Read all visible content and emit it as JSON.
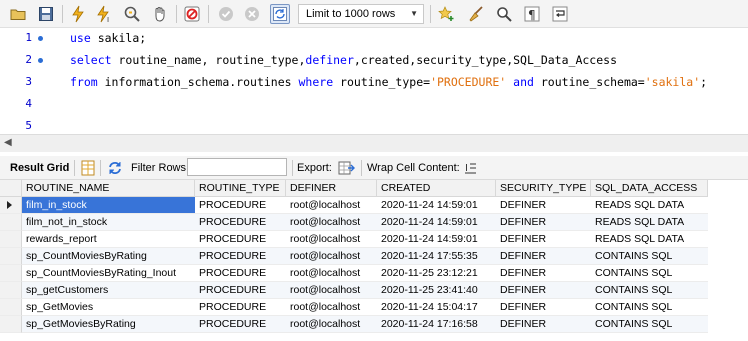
{
  "toolbar": {
    "limit_label": "Limit to 1000 rows"
  },
  "editor": {
    "lines": [
      {
        "num": "1",
        "has_dot": true
      },
      {
        "num": "2",
        "has_dot": true
      },
      {
        "num": "3",
        "has_dot": false
      },
      {
        "num": "4",
        "has_dot": false
      },
      {
        "num": "5",
        "has_dot": false
      }
    ],
    "line1": {
      "kw": "use",
      "rest": " sakila;"
    },
    "line2": {
      "kw": "select",
      "rest": " routine_name, routine_type,",
      "kw2": "definer",
      "rest2": ",created,security_type,SQL_Data_Access"
    },
    "line3": {
      "kw": "from",
      "rest": " information_schema.routines ",
      "kw2": "where",
      "rest2": " routine_type=",
      "str1": "'PROCEDURE'",
      "rest3": " ",
      "kw3": "and",
      "rest4": " routine_schema=",
      "str2": "'sakila'",
      "rest5": ";"
    }
  },
  "results_toolbar": {
    "tab_label": "Result Grid",
    "filter_label": "Filter Rows:",
    "filter_value": "",
    "export_label": "Export:",
    "wrap_label": "Wrap Cell Content:"
  },
  "grid": {
    "columns": [
      "ROUTINE_NAME",
      "ROUTINE_TYPE",
      "DEFINER",
      "CREATED",
      "SECURITY_TYPE",
      "SQL_DATA_ACCESS"
    ],
    "rows": [
      [
        "film_in_stock",
        "PROCEDURE",
        "root@localhost",
        "2020-11-24 14:59:01",
        "DEFINER",
        "READS SQL DATA"
      ],
      [
        "film_not_in_stock",
        "PROCEDURE",
        "root@localhost",
        "2020-11-24 14:59:01",
        "DEFINER",
        "READS SQL DATA"
      ],
      [
        "rewards_report",
        "PROCEDURE",
        "root@localhost",
        "2020-11-24 14:59:01",
        "DEFINER",
        "READS SQL DATA"
      ],
      [
        "sp_CountMoviesByRating",
        "PROCEDURE",
        "root@localhost",
        "2020-11-24 17:55:35",
        "DEFINER",
        "CONTAINS SQL"
      ],
      [
        "sp_CountMoviesByRating_Inout",
        "PROCEDURE",
        "root@localhost",
        "2020-11-25 23:12:21",
        "DEFINER",
        "CONTAINS SQL"
      ],
      [
        "sp_getCustomers",
        "PROCEDURE",
        "root@localhost",
        "2020-11-25 23:41:40",
        "DEFINER",
        "CONTAINS SQL"
      ],
      [
        "sp_GetMovies",
        "PROCEDURE",
        "root@localhost",
        "2020-11-24 15:04:17",
        "DEFINER",
        "CONTAINS SQL"
      ],
      [
        "sp_GetMoviesByRating",
        "PROCEDURE",
        "root@localhost",
        "2020-11-24 17:16:58",
        "DEFINER",
        "CONTAINS SQL"
      ]
    ],
    "selected_row": 0
  },
  "colors": {
    "selection": "#3874d8",
    "keyword": "#0000ff",
    "string": "#e0700f"
  }
}
